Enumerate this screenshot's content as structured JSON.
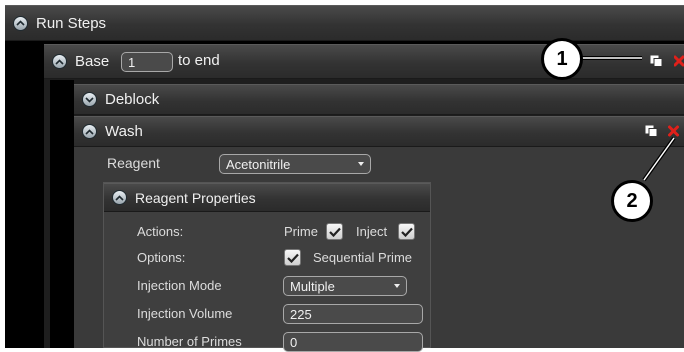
{
  "run_steps": {
    "title": "Run Steps"
  },
  "base": {
    "prefix": "Base",
    "value": "1",
    "suffix": "to end"
  },
  "deblock": {
    "title": "Deblock"
  },
  "wash": {
    "title": "Wash",
    "reagent_label": "Reagent",
    "reagent_value": "Acetonitrile"
  },
  "reagent_properties": {
    "title": "Reagent Properties",
    "actions_label": "Actions:",
    "prime_label": "Prime",
    "inject_label": "Inject",
    "options_label": "Options:",
    "sequential_prime_label": "Sequential Prime",
    "injection_mode_label": "Injection Mode",
    "injection_mode_value": "Multiple",
    "injection_volume_label": "Injection Volume",
    "injection_volume_value": "225",
    "number_of_primes_label": "Number of Primes",
    "number_of_primes_value": "0"
  },
  "callouts": {
    "one": "1",
    "two": "2"
  },
  "colors": {
    "delete_red": "#e0201a",
    "panel_bg": "#3a3a3a",
    "frame_bg": "#000000"
  }
}
